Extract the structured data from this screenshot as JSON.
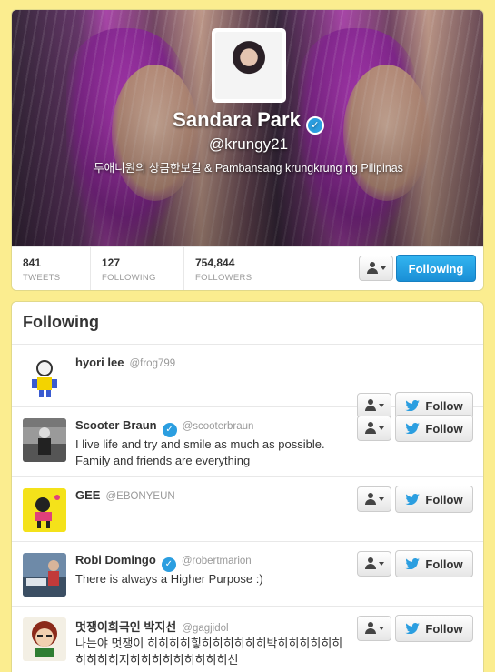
{
  "profile": {
    "name": "Sandara Park",
    "handle": "@krungy21",
    "bio": "투애니원의 상큼한보컬 & Pambansang krungkrung ng Pilipinas",
    "verified": true,
    "accent_color": "#2b9ee0"
  },
  "stats": [
    {
      "value": "841",
      "label": "TWEETS"
    },
    {
      "value": "127",
      "label": "FOLLOWING"
    },
    {
      "value": "754,844",
      "label": "FOLLOWERS"
    }
  ],
  "buttons": {
    "following_label": "Following",
    "follow_label": "Follow",
    "user_menu_icon": "user-dropdown-icon",
    "follow_icon": "twitter-bird-icon"
  },
  "following": {
    "title": "Following",
    "users": [
      {
        "name": "hyori lee",
        "handle": "@frog799",
        "bio": "",
        "verified": false
      },
      {
        "name": "Scooter Braun",
        "handle": "@scooterbraun",
        "bio": "I live life and try and smile as much as possible. Family and friends are everything",
        "verified": true
      },
      {
        "name": "GEE",
        "handle": "@EBONYEUN",
        "bio": "",
        "verified": false
      },
      {
        "name": "Robi Domingo",
        "handle": "@robertmarion",
        "bio": "There is always a Higher Purpose :)",
        "verified": true
      },
      {
        "name": "멋쟁이희극인 박지선",
        "handle": "@gagjidol",
        "bio": "나는야 멋쟁이 히히히히힣히히히히히히박히히히히히히히히히히지히히히히히히히히히선",
        "verified": false
      }
    ]
  }
}
